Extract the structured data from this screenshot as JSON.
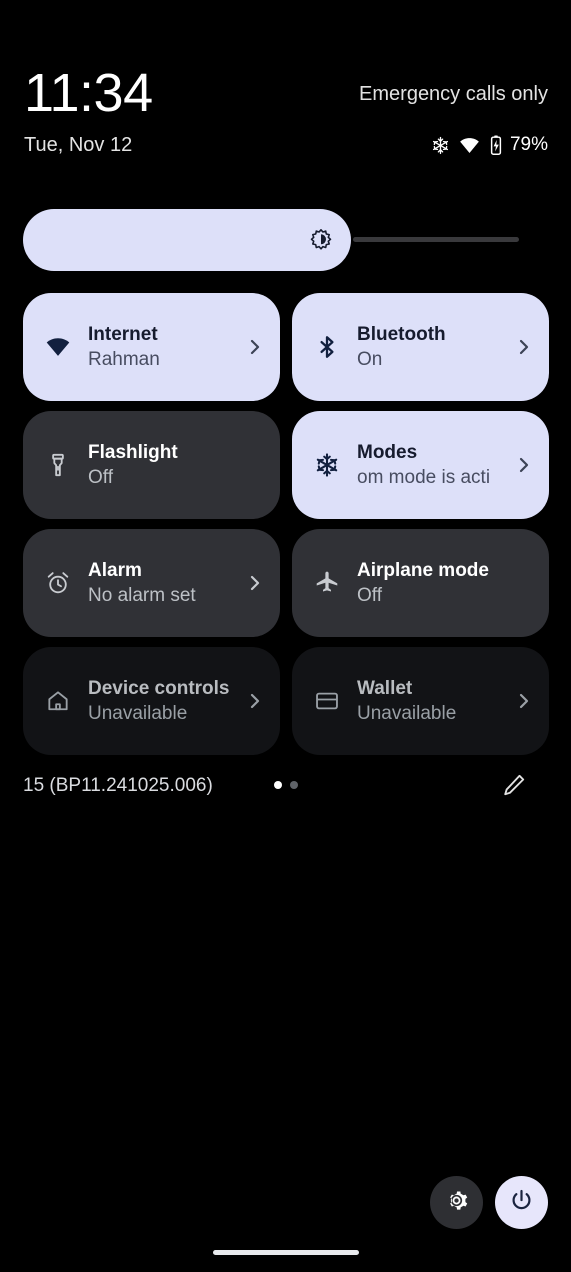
{
  "status": {
    "time": "11:34",
    "date": "Tue, Nov 12",
    "carrier": "Emergency calls only",
    "battery_percent": "79%",
    "icons": [
      "snowflake-icon",
      "wifi-icon",
      "battery-charging-icon"
    ]
  },
  "brightness": {
    "name": "brightness-slider",
    "icon": "brightness-icon",
    "value_percent": 66
  },
  "tiles": [
    {
      "id": "internet",
      "icon": "wifi-icon",
      "title": "Internet",
      "subtitle": "Rahman",
      "state": "active",
      "chevron": true
    },
    {
      "id": "bluetooth",
      "icon": "bluetooth-icon",
      "title": "Bluetooth",
      "subtitle": "On",
      "state": "active",
      "chevron": true
    },
    {
      "id": "flashlight",
      "icon": "flashlight-icon",
      "title": "Flashlight",
      "subtitle": "Off",
      "state": "inactive",
      "chevron": false
    },
    {
      "id": "modes",
      "icon": "snowflake-icon",
      "title": "Modes",
      "subtitle": "om mode is acti",
      "state": "active",
      "chevron": true,
      "subtitle_marquee": true
    },
    {
      "id": "alarm",
      "icon": "alarm-clock-icon",
      "title": "Alarm",
      "subtitle": "No alarm set",
      "state": "inactive",
      "chevron": true
    },
    {
      "id": "airplane-mode",
      "icon": "airplane-icon",
      "title": "Airplane mode",
      "subtitle": "Off",
      "state": "inactive",
      "chevron": false
    },
    {
      "id": "device-controls",
      "icon": "home-icon",
      "title": "Device controls",
      "subtitle": "Unavailable",
      "state": "unavailable",
      "chevron": true
    },
    {
      "id": "wallet",
      "icon": "credit-card-icon",
      "title": "Wallet",
      "subtitle": "Unavailable",
      "state": "unavailable",
      "chevron": true
    }
  ],
  "footer": {
    "build_label": "15 (BP11.241025.006)",
    "page_count": 2,
    "active_page": 1,
    "edit_icon": "pencil-icon"
  },
  "bottom_actions": {
    "settings_icon": "gear-icon",
    "power_icon": "power-icon"
  },
  "colors": {
    "background": "#000000",
    "tile_active": "#dde0f9",
    "tile_inactive": "#303136",
    "tile_unavailable": "#121316",
    "accent_dark": "#161b2e"
  }
}
